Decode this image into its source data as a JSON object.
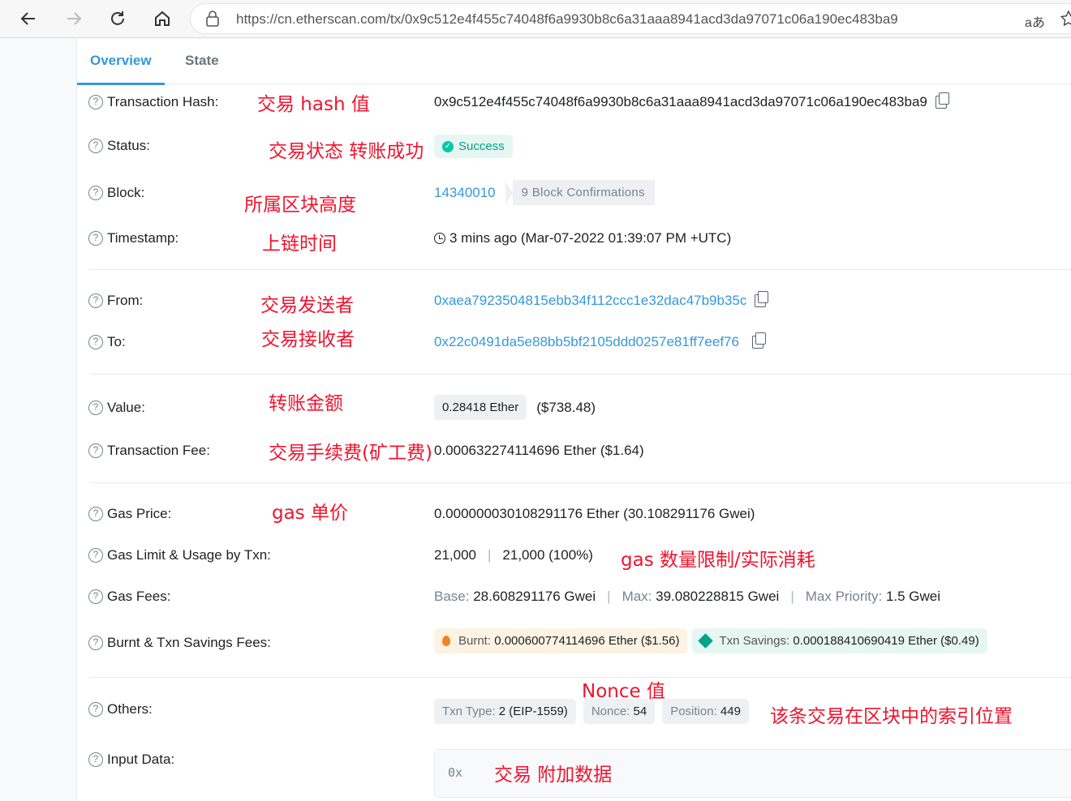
{
  "browser": {
    "url": "https://cn.etherscan.com/tx/0x9c512e4f455c74048f6a9930b8c6a31aaa8941acd3da97071c06a190ec483ba9",
    "translate_label": "aあ"
  },
  "tabs": [
    "Overview",
    "State"
  ],
  "fields": {
    "tx_hash": {
      "label": "Transaction Hash:",
      "value": "0x9c512e4f455c74048f6a9930b8c6a31aaa8941acd3da97071c06a190ec483ba9"
    },
    "status": {
      "label": "Status:",
      "value": "Success"
    },
    "block": {
      "label": "Block:",
      "value": "14340010",
      "confirmations": "9 Block Confirmations"
    },
    "timestamp": {
      "label": "Timestamp:",
      "value": "3 mins ago (Mar-07-2022 01:39:07 PM +UTC)"
    },
    "from": {
      "label": "From:",
      "value": "0xaea7923504815ebb34f112ccc1e32dac47b9b35c"
    },
    "to": {
      "label": "To:",
      "value": "0x22c0491da5e88bb5bf2105ddd0257e81ff7eef76"
    },
    "value": {
      "label": "Value:",
      "ether": "0.28418 Ether",
      "usd": "($738.48)"
    },
    "fee": {
      "label": "Transaction Fee:",
      "value": "0.000632274114696 Ether ($1.64)"
    },
    "gas_price": {
      "label": "Gas Price:",
      "value": "0.000000030108291176 Ether (30.108291176 Gwei)"
    },
    "gas_limit": {
      "label": "Gas Limit & Usage by Txn:",
      "limit": "21,000",
      "sep": "|",
      "usage": "21,000 (100%)"
    },
    "gas_fees": {
      "label": "Gas Fees:",
      "base_label": "Base:",
      "base": "28.608291176 Gwei",
      "max_label": "Max:",
      "max": "39.080228815 Gwei",
      "priority_label": "Max Priority:",
      "priority": "1.5 Gwei"
    },
    "burnt": {
      "label": "Burnt & Txn Savings Fees:",
      "burnt_label": "Burnt:",
      "burnt_value": "0.000600774114696 Ether ($1.56)",
      "savings_label": "Txn Savings:",
      "savings_value": "0.000188410690419 Ether ($0.49)"
    },
    "others": {
      "label": "Others:",
      "txn_type_label": "Txn Type:",
      "txn_type": "2 (EIP-1559)",
      "nonce_label": "Nonce:",
      "nonce": "54",
      "position_label": "Position:",
      "position": "449"
    },
    "input": {
      "label": "Input Data:",
      "value": "0x"
    }
  },
  "annotations": {
    "tx_hash": "交易 hash 值",
    "status": "交易状态  转账成功",
    "block": "所属区块高度",
    "timestamp": "上链时间",
    "from": "交易发送者",
    "to": "交易接收者",
    "value": "转账金额",
    "fee": "交易手续费(矿工费)",
    "gas_price": "gas 单价",
    "gas_limit": "gas 数量限制/实际消耗",
    "nonce": "Nonce 值",
    "position": "该条交易在区块中的索引位置",
    "input": "交易 附加数据"
  },
  "colors": {
    "link": "#3498db",
    "annotation": "#f0142e",
    "success": "#00a186"
  }
}
